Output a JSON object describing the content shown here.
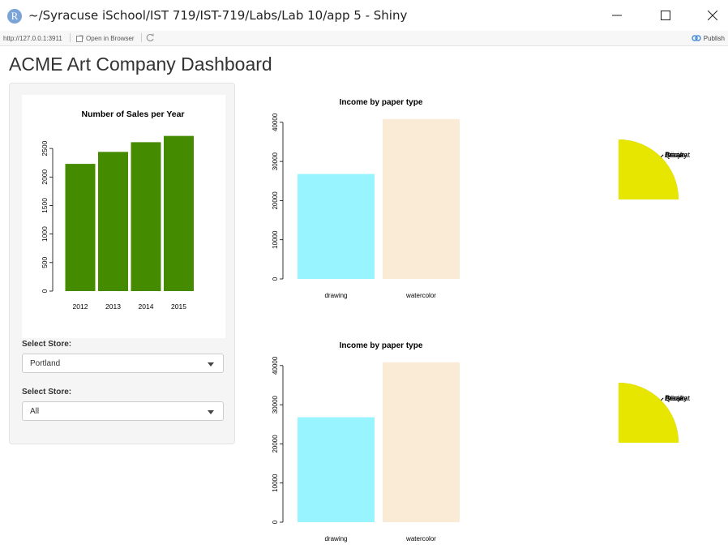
{
  "window": {
    "title": "~/Syracuse iSchool/IST 719/IST-719/Labs/Lab 10/app 5 - Shiny",
    "logo_letter": "R"
  },
  "browser_bar": {
    "url": "http://127.0.0.1:3911",
    "open_in_browser": "Open in Browser",
    "publish": "Publish"
  },
  "page": {
    "title": "ACME Art Company Dashboard"
  },
  "controls": {
    "store1_label": "Select Store:",
    "store1_value": "Portland",
    "store2_label": "Select Store:",
    "store2_value": "All"
  },
  "colors": {
    "sales_bar": "#458B00",
    "drawing": "#98F5FF",
    "watercolor": "#FAEBD7",
    "pie_aman": "#00A600",
    "pie_arinjay": "#E6E600",
    "pie_barakat": "#ECB176",
    "pie_qiaoli": "#F2F2F2"
  },
  "chart_data": [
    {
      "type": "bar",
      "title": "Number of Sales per Year",
      "categories": [
        "2012",
        "2013",
        "2014",
        "2015"
      ],
      "values": [
        2230,
        2440,
        2610,
        2720
      ],
      "yticks": [
        0,
        500,
        1000,
        1500,
        2000,
        2500
      ],
      "ylim": [
        0,
        2800
      ]
    },
    {
      "type": "bar",
      "title": "Income by paper type",
      "categories": [
        "drawing",
        "watercolor"
      ],
      "values": [
        26800,
        40800
      ],
      "yticks": [
        0,
        10000,
        20000,
        30000,
        40000
      ],
      "ylim": [
        0,
        41000
      ]
    },
    {
      "type": "pie",
      "labels": [
        "Aman",
        "Qiaoli",
        "Barakat",
        "Arinjay"
      ],
      "values": [
        25,
        25,
        25,
        25
      ],
      "colors": [
        "#00A600",
        "#F2F2F2",
        "#ECB176",
        "#E6E600"
      ]
    },
    {
      "type": "bar",
      "title": "Income by paper type",
      "categories": [
        "drawing",
        "watercolor"
      ],
      "values": [
        26800,
        40800
      ],
      "yticks": [
        0,
        10000,
        20000,
        30000,
        40000
      ],
      "ylim": [
        0,
        41000
      ]
    },
    {
      "type": "pie",
      "labels": [
        "Aman",
        "Qiaoli",
        "Barakat",
        "Arinjay"
      ],
      "values": [
        25,
        25,
        25,
        25
      ],
      "colors": [
        "#00A600",
        "#F2F2F2",
        "#ECB176",
        "#E6E600"
      ]
    }
  ]
}
